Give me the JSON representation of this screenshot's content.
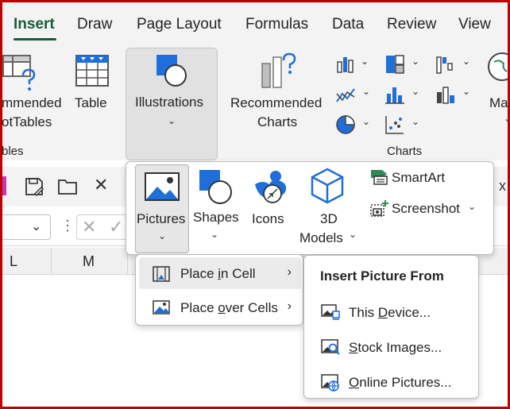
{
  "tabs": [
    {
      "label": "Insert",
      "active": true
    },
    {
      "label": "Draw"
    },
    {
      "label": "Page Layout"
    },
    {
      "label": "Formulas"
    },
    {
      "label": "Data"
    },
    {
      "label": "Review"
    },
    {
      "label": "View"
    }
  ],
  "ribbon": {
    "pivot_line1": "mmended",
    "pivot_line2": "otTables",
    "table_label": "Table",
    "illustrations_label": "Illustrations",
    "rec_charts_line1": "Recommended",
    "rec_charts_line2": "Charts",
    "maps_partial": "Ma",
    "group_tables_partial": "bles",
    "group_charts": "Charts"
  },
  "formula_bar": {
    "name_box_value": "",
    "formula_value": ""
  },
  "columns": [
    "L",
    "M"
  ],
  "illustrations_menu": {
    "pictures": "Pictures",
    "shapes": "Shapes",
    "icons": "Icons",
    "models_line1": "3D",
    "models_line2": "Models",
    "smartart": "SmartArt",
    "screenshot": "Screenshot"
  },
  "pictures_menu": {
    "items": [
      {
        "pre": "Place ",
        "key": "i",
        "post": "n Cell",
        "highlighted": true
      },
      {
        "pre": "Place ",
        "key": "o",
        "post": "ver Cells",
        "highlighted": false
      }
    ]
  },
  "insert_from_menu": {
    "header": "Insert Picture From",
    "items": [
      {
        "pre": "This ",
        "key": "D",
        "post": "evice..."
      },
      {
        "pre": "",
        "key": "S",
        "post": "tock Images..."
      },
      {
        "pre": "",
        "key": "O",
        "post": "nline Pictures..."
      }
    ]
  },
  "colors": {
    "frame": "#c00000",
    "accent": "#185c37",
    "icon_blue": "#1e6fd9"
  }
}
